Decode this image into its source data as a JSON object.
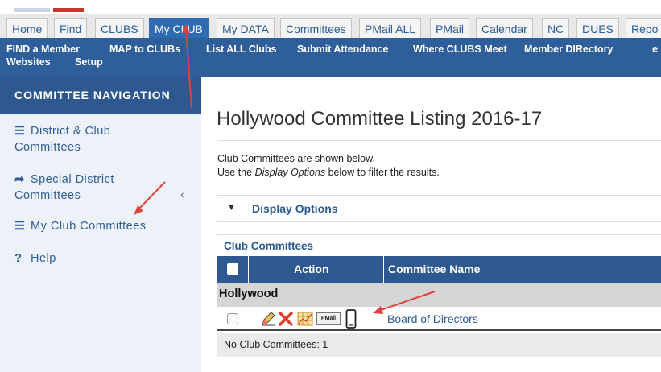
{
  "tabs": [
    {
      "label": "Home",
      "active": false
    },
    {
      "label": "Find",
      "active": false
    },
    {
      "label": "CLUBS",
      "active": false
    },
    {
      "label": "My CLUB",
      "active": true
    },
    {
      "label": "My DATA",
      "active": false
    },
    {
      "label": "Committees",
      "active": false
    },
    {
      "label": "PMail ALL",
      "active": false
    },
    {
      "label": "PMail",
      "active": false
    },
    {
      "label": "Calendar",
      "active": false
    },
    {
      "label": "NC",
      "active": false
    },
    {
      "label": "DUES",
      "active": false
    },
    {
      "label": "Repo",
      "active": false
    }
  ],
  "subnav": {
    "links": [
      "FIND a Member",
      "MAP to CLUBs",
      "List ALL Clubs",
      "Submit Attendance",
      "Where CLUBS Meet",
      "Member DIRectory",
      "e"
    ],
    "links_row2": [
      "Websites",
      "Setup"
    ]
  },
  "sidebar": {
    "heading": "COMMITTEE NAVIGATION",
    "items": [
      {
        "line1": "District & Club",
        "line2": "Committees",
        "icon": "list-icon"
      },
      {
        "line1": "Special District",
        "line2": "Committees",
        "icon": "share-arrow-icon"
      },
      {
        "line1": "My Club Committees",
        "line2": "",
        "icon": "list-icon"
      },
      {
        "line1": "Help",
        "line2": "",
        "icon": "question-icon"
      }
    ],
    "chevron": "‹"
  },
  "main": {
    "title": "Hollywood Committee Listing 2016-17",
    "intro_line1": "Club Committees are shown below.",
    "intro_line2_pre": "Use the ",
    "intro_line2_em": "Display Options",
    "intro_line2_post": " below to filter the results.",
    "display_options_label": "Display Options"
  },
  "committees": {
    "title": "Club Committees",
    "headers": {
      "action": "Action",
      "name": "Committee Name"
    },
    "group": "Hollywood",
    "rows": [
      {
        "name": "Board of Directors",
        "actions": [
          "pencil-edit-icon",
          "delete-x-icon",
          "grid-report-icon",
          "pmail-icon",
          "mobile-phone-icon"
        ]
      }
    ],
    "pmail_icon_text": "PMail",
    "count_text": "No Club Committees: 1"
  },
  "colors": {
    "nav_blue": "#2e5f9a",
    "link_blue": "#2b5a93",
    "annotation_red": "#e0413a"
  }
}
